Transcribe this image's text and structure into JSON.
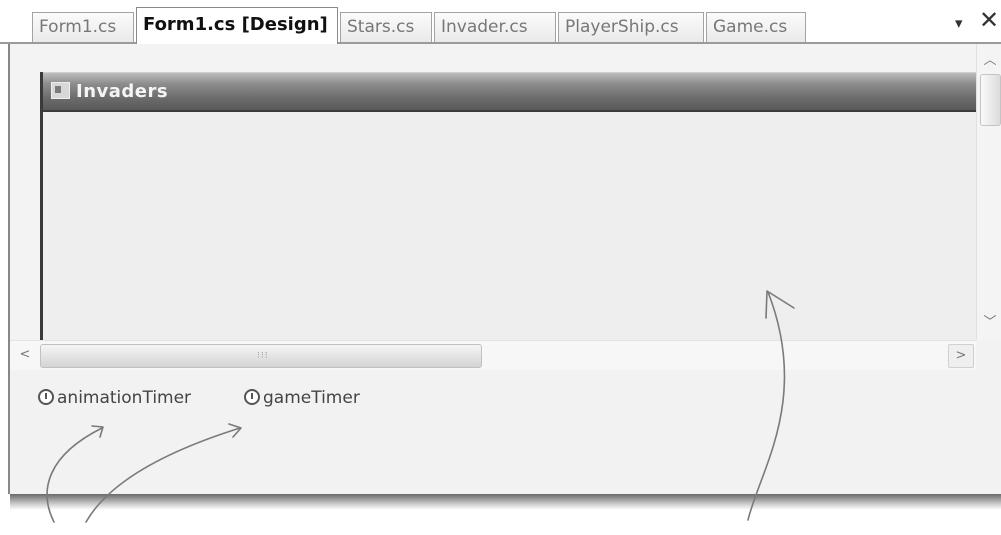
{
  "tabs": [
    {
      "label": "Form1.cs",
      "active": false
    },
    {
      "label": "Form1.cs [Design]",
      "active": true
    },
    {
      "label": "Stars.cs",
      "active": false
    },
    {
      "label": "Invader.cs",
      "active": false
    },
    {
      "label": "PlayerShip.cs",
      "active": false
    },
    {
      "label": "Game.cs",
      "active": false
    }
  ],
  "tab_controls": {
    "dropdown_icon": "chevron-down-icon",
    "close_icon": "close-icon",
    "dropdown_glyph": "▾",
    "close_glyph": "✕"
  },
  "form": {
    "title": "Invaders",
    "icon": "form-icon"
  },
  "scrollbars": {
    "up_glyph": "︿",
    "down_glyph": "﹀",
    "left_glyph": "<",
    "right_glyph": ">",
    "grip_glyph": "⁝⁝⁝"
  },
  "tray": {
    "components": [
      {
        "name": "animationTimer",
        "icon": "timer-icon"
      },
      {
        "name": "gameTimer",
        "icon": "timer-icon"
      }
    ]
  },
  "colors": {
    "titlebar": "#6a6a6a",
    "surface": "#eeeeee",
    "annotation": "#7a7a7a"
  }
}
